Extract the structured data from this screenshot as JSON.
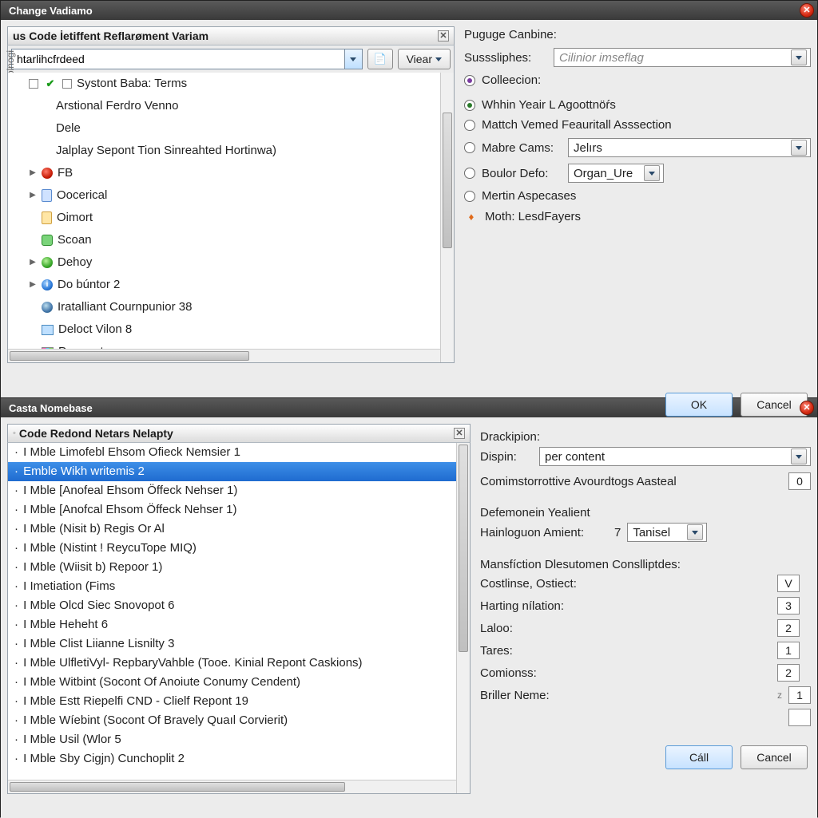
{
  "dialog1": {
    "title": "Change Vadiamo",
    "panelTitle": "us Code İetiffent Reflarøment Variam",
    "sideLabel": "olnogi",
    "searchValue": "htarlihcfrdeed",
    "viewBtn": "Viear",
    "tree": [
      {
        "icon": "square",
        "exp": "box",
        "label": "Systont Baba: Terms",
        "depth": 1,
        "check": true
      },
      {
        "icon": "",
        "label": "Arstional Ferdro Venno",
        "depth": 2
      },
      {
        "icon": "",
        "label": "Dele",
        "depth": 2
      },
      {
        "icon": "",
        "label": "Jalplay Sepont Tion Sinreahted Hortinwa)",
        "depth": 2
      },
      {
        "icon": "red",
        "exp": "tri",
        "label": "FB",
        "depth": 1
      },
      {
        "icon": "doc",
        "exp": "tri",
        "label": "Oocerical",
        "depth": 1
      },
      {
        "icon": "docy",
        "label": "Oimort",
        "depth": 1,
        "pad": true
      },
      {
        "icon": "green",
        "label": "Scoan",
        "depth": 1,
        "pad": true
      },
      {
        "icon": "greenball",
        "exp": "tri",
        "label": "Dehoy",
        "depth": 1
      },
      {
        "icon": "info",
        "exp": "tri",
        "label": "Do búntor 2",
        "depth": 1
      },
      {
        "icon": "globe",
        "label": "Iratalliant Cournpunior 38",
        "depth": 1,
        "pad": true
      },
      {
        "icon": "pic",
        "label": "Deloct Vilon 8",
        "depth": 1,
        "pad": true
      },
      {
        "icon": "chart",
        "label": "Proprest",
        "depth": 1,
        "pad": true
      }
    ],
    "right": {
      "l1": "Puguge Canbine:",
      "l2": "Susssliphes:",
      "placeholder2": "Cilinior imseflag",
      "l3": "Colleecion:",
      "r1": "Whhin Yeair L Agoottnöŕs",
      "r2": "Mattch Vemed Feauritall Asssection",
      "r3": "Mabre Cams:",
      "r3val": "Jelırs",
      "r4": "Boulor Defo:",
      "r4val": "Organ_Ure",
      "r5": "Mertin Aspecases",
      "r6": "Moth: LesdFayers",
      "ok": "OK",
      "cancel": "Cancel"
    }
  },
  "dialog2": {
    "title": "Casta Nomebase",
    "panelTitle": "Code Redond Netars Nelapty",
    "list": [
      "I Mble Limofebl Ehsom Ofieck Nemsier 1",
      "Emble Wikh writemis 2",
      "I Mble [Anofeal Ehsom Öffeck Nehser 1)",
      "I Mble [Anofcal Ehsom Öffeck Nehser 1)",
      "I Mble (Nisit b) Regis Or Al",
      "I Mble (Nistint ! ReycuTope MIQ)",
      "I Mble (Wiisit b) Repoor 1)",
      "I Imetiation (Fims",
      "I Mble Olcd Siec Snovopot 6",
      "I Mble Heheht 6",
      "I Mble Clist Liianne Lisnilty 3",
      "I Mble UlfletiVyl- RepbaryVahble (Tooe. Kinial Repont Caskions)",
      "I Mble Witbint (Socont Of Anoiute Conumy Cendent)",
      "I Mble Estt Riepelfi CND - Clielf Repont 19",
      "I Mble Wíebint (Socont Of Bravely Quaıl Corvierit)",
      "I Mble Usil (Wlor 5",
      "I Mble Sby Cigjn) Cunchoplit 2"
    ],
    "selectedIndex": 1,
    "right": {
      "l1": "Drackipion:",
      "l2": "Dispin:",
      "l2val": "per content",
      "l3": "Comimstorrottive Avourdtogs Aasteal",
      "l3val": "0",
      "sec1": "Defemonein Yealient",
      "l4": "Hainloguon Amient:",
      "l4num": "7",
      "l4val": "Tanisel",
      "sec2": "Mansfíction Dlesutomen Conslliptdes:",
      "rows": [
        {
          "label": "Costlinse, Ostiect:",
          "val": "V"
        },
        {
          "label": "Harting nílation:",
          "val": "3"
        },
        {
          "label": "Laloo:",
          "val": "2"
        },
        {
          "label": "Tares:",
          "val": "1"
        },
        {
          "label": "Comionss:",
          "val": "2"
        },
        {
          "label": "Briller Neme:",
          "pre": "z",
          "val": "1"
        }
      ],
      "ok": "Cáll",
      "cancel": "Cancel"
    }
  }
}
